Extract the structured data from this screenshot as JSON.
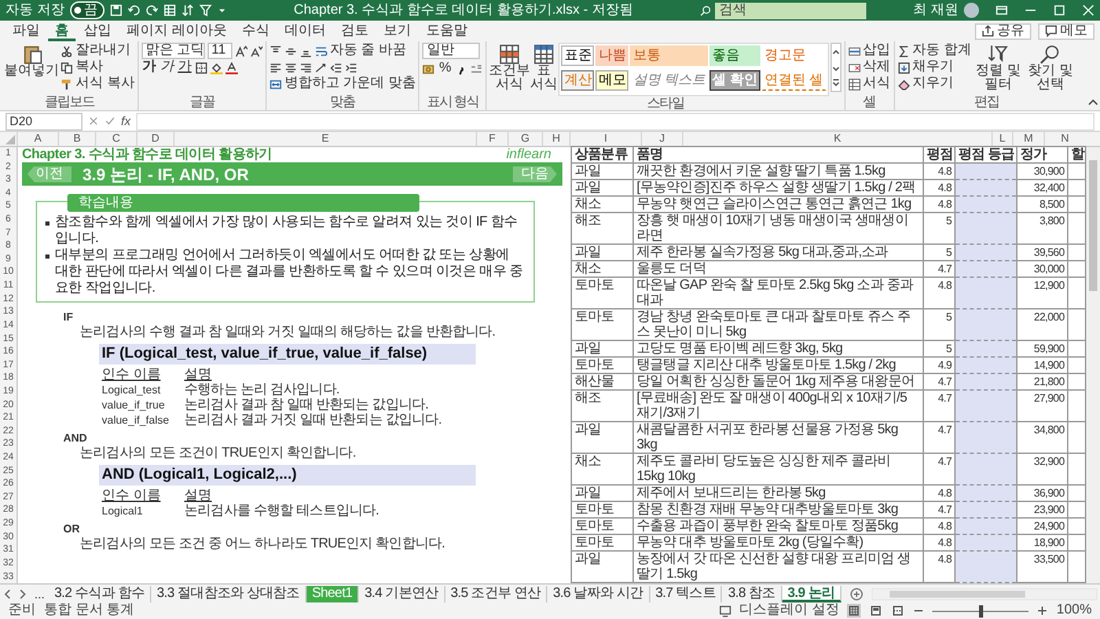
{
  "title_bar": {
    "autosave_label": "자동 저장",
    "autosave_toggle": {
      "text": "끔",
      "on": false
    },
    "title": "Chapter 3. 수식과 함수로 데이터 활용하기.xlsx - 저장됨",
    "search": {
      "placeholder": "검색"
    },
    "user_name": "최 재원"
  },
  "ribbon_tabs": [
    {
      "label": "파일",
      "selected": false
    },
    {
      "label": "홈",
      "selected": true
    },
    {
      "label": "삽입",
      "selected": false
    },
    {
      "label": "페이지 레이아웃",
      "selected": false
    },
    {
      "label": "수식",
      "selected": false
    },
    {
      "label": "데이터",
      "selected": false
    },
    {
      "label": "검토",
      "selected": false
    },
    {
      "label": "보기",
      "selected": false
    },
    {
      "label": "도움말",
      "selected": false
    }
  ],
  "ribbon_actions": {
    "share": "공유",
    "comments": "메모"
  },
  "clipboard": {
    "label": "클립보드",
    "paste": "붙여넣기",
    "cut": "잘라내기",
    "copy": "복사",
    "format_painter": "서식 복사"
  },
  "font": {
    "label": "글꼴",
    "font_name": "맑은 고딕",
    "font_size": "11",
    "bold": "가",
    "italic": "가",
    "underline": "가"
  },
  "alignment": {
    "label": "맞춤",
    "wrap_text": "자동 줄 바꿈",
    "merge_center": "병합하고 가운데 맞춤"
  },
  "number": {
    "label": "표시 형식",
    "format": "일반",
    "percent": "%"
  },
  "styles": {
    "label": "스타일",
    "conditional": "조건부 서식",
    "table": "표 서식",
    "cell_styles": [
      {
        "label": "표준",
        "kind": "normal"
      },
      {
        "label": "나쁨",
        "kind": "bad"
      },
      {
        "label": "보통",
        "kind": "neutral"
      },
      {
        "label": "좋음",
        "kind": "good"
      },
      {
        "label": "경고문",
        "kind": "warning"
      },
      {
        "label": "계산",
        "kind": "calculation"
      },
      {
        "label": "메모",
        "kind": "note"
      },
      {
        "label": "설명 텍스트",
        "kind": "explanatory"
      },
      {
        "label": "셀 확인",
        "kind": "check"
      },
      {
        "label": "연결된 셀",
        "kind": "linked"
      }
    ]
  },
  "cells": {
    "label": "셀",
    "insert": "삽입",
    "delete": "삭제",
    "format": "서식"
  },
  "editing": {
    "label": "편집",
    "autosum": "자동 합계",
    "fill": "채우기",
    "clear": "지우기",
    "sort_filter": "정렬 및 필터",
    "find_select": "찾기 및 선택"
  },
  "formula_bar": {
    "name_box": "D20",
    "function_label": "fx"
  },
  "column_headers": [
    "A",
    "B",
    "C",
    "D",
    "E",
    "F",
    "G",
    "H",
    "I",
    "J",
    "K",
    "L",
    "M",
    "N"
  ],
  "row_numbers": [
    "1",
    "2",
    "3",
    "4",
    "5",
    "6",
    "7",
    "8",
    "9",
    "10",
    "11",
    "12",
    "13",
    "14",
    "15",
    "16",
    "17",
    "18",
    "19",
    "20",
    "21",
    "22",
    "23",
    "24",
    "25",
    "26",
    "27",
    "28",
    "29",
    "30",
    "31",
    "32",
    "33"
  ],
  "sheet": {
    "chapter_title": "Chapter 3. 수식과 함수로 데이터 활용하기",
    "logo": "inflearn",
    "banner": {
      "prev": "이전",
      "title": "3.9 논리 - IF, AND, OR",
      "next": "다음"
    },
    "learning_box": {
      "header": "학습내용",
      "bullets": [
        "참조함수와 함께 엑셀에서 가장 많이 사용되는 함수로 알려져 있는 것이 IF 함수입니다.",
        "대부분의 프로그래밍 언어에서 그러하듯이 엑셀에서도 어떠한 값 또는 상황에 대한 판단에 따라서 엑셀이 다른 결과를 반환하도록 할 수 있으며 이것은 매우 중요한 작업입니다."
      ]
    },
    "functions": [
      {
        "name": "IF",
        "description": "논리검사의 수행 결과 참 일때와 거짓 일때의 해당하는 값을 반환합니다.",
        "syntax": "IF (Logical_test, value_if_true, value_if_false)",
        "arg_header": [
          "인수 이름",
          "설명"
        ],
        "args": [
          [
            "Logical_test",
            "수행하는 논리 검사입니다."
          ],
          [
            "value_if_true",
            "논리검사 결과 참 일때 반환되는 값입니다."
          ],
          [
            "value_if_false",
            "논리검사 결과 거짓 일때 반환되는 값입니다."
          ]
        ]
      },
      {
        "name": "AND",
        "description": "논리검사의 모든 조건이 TRUE인지 확인합니다.",
        "syntax": "AND (Logical1, Logical2,...)",
        "arg_header": [
          "인수 이름",
          "설명"
        ],
        "args": [
          [
            "Logical1",
            "논리검사를 수행할 테스트입니다."
          ]
        ]
      },
      {
        "name": "OR",
        "description": "논리검사의 모든 조건 중 어느 하나라도 TRUE인지 확인합니다."
      }
    ],
    "product_table": {
      "columns": [
        "상품분류",
        "품명",
        "평점",
        "평점 등급",
        "정가",
        "할"
      ],
      "rows": [
        {
          "category": "과일",
          "name": "깨끗한 환경에서 키운 설향 딸기 특품 1.5kg",
          "rating": "4.8",
          "price": "30,900"
        },
        {
          "category": "과일",
          "name": "[무농약인증]진주 하우스 설향 생딸기 1.5kg / 2팩",
          "rating": "4.8",
          "price": "32,400"
        },
        {
          "category": "채소",
          "name": "무농약 햇연근 슬라이스연근 통연근 흙연근 1kg",
          "rating": "4.8",
          "price": "8,500"
        },
        {
          "category": "해조",
          "name": "장흥 햇 매생이 10재기 냉동 매생이국 생매생이 라면",
          "rating": "5",
          "price": "3,800"
        },
        {
          "category": "과일",
          "name": "제주 한라봉 실속가정용 5kg 대과,중과,소과",
          "rating": "5",
          "price": "39,560"
        },
        {
          "category": "채소",
          "name": "울릉도 더덕",
          "rating": "4.7",
          "price": "30,000"
        },
        {
          "category": "토마토",
          "name": "따온날 GAP 완숙 찰 토마토 2.5kg 5kg 소과 중과 대과",
          "rating": "4.8",
          "price": "12,900"
        },
        {
          "category": "토마토",
          "name": "경남 창녕 완숙토마토 큰 대과 찰토마토 쥬스 주스 못난이 미니 5kg",
          "rating": "5",
          "price": "22,000"
        },
        {
          "category": "과일",
          "name": "고당도 명품 타이벡 레드향 3kg, 5kg",
          "rating": "5",
          "price": "59,900"
        },
        {
          "category": "토마토",
          "name": "탱글탱글 지리산 대추 방울토마토 1.5kg / 2kg",
          "rating": "4.9",
          "price": "14,900"
        },
        {
          "category": "해산물",
          "name": "당일 어획한 싱싱한 돌문어 1kg 제주용 대왕문어",
          "rating": "4.7",
          "price": "21,800"
        },
        {
          "category": "해조",
          "name": "[무료배송] 완도 잘 매생이 400g내외 x 10재기/5재기/3재기",
          "rating": "4.7",
          "price": "27,900"
        },
        {
          "category": "과일",
          "name": "새콤달콤한 서귀포 한라봉 선물용 가정용 5kg 3kg",
          "rating": "4.7",
          "price": "34,800"
        },
        {
          "category": "채소",
          "name": "제주도 콜라비 당도높은 싱싱한 제주 콜라비 15kg 10kg",
          "rating": "4.7",
          "price": "32,900"
        },
        {
          "category": "과일",
          "name": "제주에서 보내드리는 한라봉 5kg",
          "rating": "4.8",
          "price": "36,900"
        },
        {
          "category": "토마토",
          "name": "참몽 친환경 재배 무농약 대추방울토마토 3kg",
          "rating": "4.7",
          "price": "23,900"
        },
        {
          "category": "토마토",
          "name": "수출용 과즙이 풍부한 완숙 찰토마토 정품5kg",
          "rating": "4.8",
          "price": "24,900"
        },
        {
          "category": "토마토",
          "name": "무농약 대추 방울토마토 2kg (당일수확)",
          "rating": "4.8",
          "price": "18,900"
        },
        {
          "category": "과일",
          "name": "농장에서 갓 따온 신선한 설향 대왕 프리미엄 생딸기 1.5kg",
          "rating": "4.8",
          "price": "33,500"
        }
      ]
    }
  },
  "sheet_tabs": {
    "more": "...",
    "tabs": [
      {
        "label": "3.2 수식과 함수",
        "selected": false
      },
      {
        "label": "3.3 절대참조와 상대참조",
        "selected": false
      },
      {
        "label": "Sheet1",
        "selected": false,
        "color": "#3fae49"
      },
      {
        "label": "3.4 기본연산",
        "selected": false
      },
      {
        "label": "3.5 조건부 연산",
        "selected": false
      },
      {
        "label": "3.6 날짜와 시간",
        "selected": false
      },
      {
        "label": "3.7 텍스트",
        "selected": false
      },
      {
        "label": "3.8 참조",
        "selected": false
      },
      {
        "label": "3.9 논리",
        "selected": true
      }
    ]
  },
  "status_bar": {
    "ready": "준비",
    "workbook_stats": "통합 문서 통계",
    "display_settings": "디스플레이 설정",
    "views": [
      {
        "kind": "normal",
        "selected": true
      },
      {
        "kind": "page_layout",
        "selected": false
      },
      {
        "kind": "page_break",
        "selected": false
      }
    ],
    "zoom": {
      "level": 0.5
    },
    "zoom_percent": "100%"
  }
}
